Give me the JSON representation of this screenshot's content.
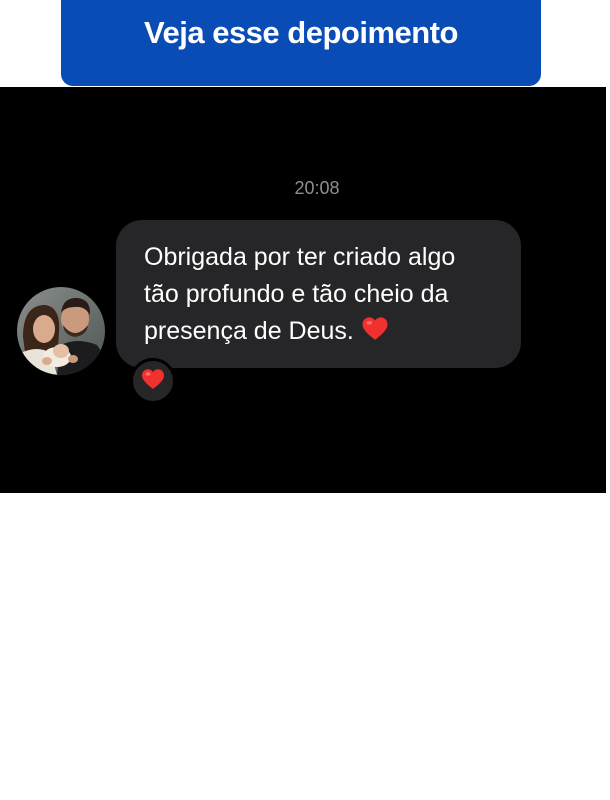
{
  "banner": {
    "title": "Veja esse depoimento",
    "color": "#0a4cb5"
  },
  "chat": {
    "timestamp": "20:08",
    "message": {
      "lines": [
        "Obrigada por ter criado algo",
        "tão profundo e tão cheio da",
        "presença de Deus. "
      ],
      "emoji": "heart-icon"
    },
    "reaction": "heart-icon",
    "background_color": "#000000",
    "bubble_color": "#262628"
  }
}
